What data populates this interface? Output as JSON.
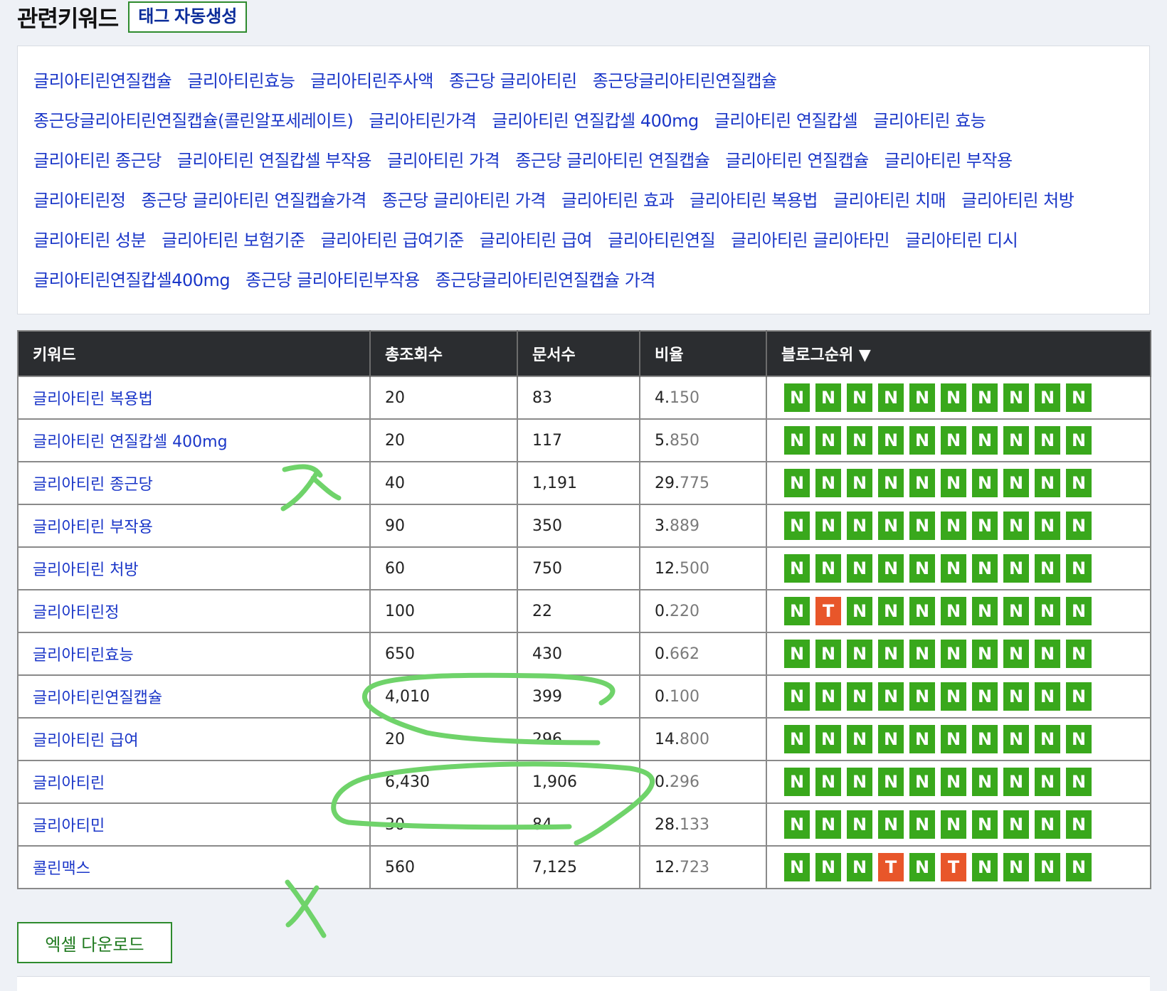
{
  "header": {
    "title": "관련키워드",
    "tag_button": "태그 자동생성"
  },
  "related_keywords": [
    [
      "글리아티린연질캡슐",
      "글리아티린효능",
      "글리아티린주사액",
      "종근당 글리아티린",
      "종근당글리아티린연질캡슐"
    ],
    [
      "종근당글리아티린연질캡슐(콜린알포세레이트)",
      "글리아티린가격",
      "글리아티린 연질캅셀 400mg",
      "글리아티린 연질캅셀",
      "글리아티린 효능"
    ],
    [
      "글리아티린 종근당",
      "글리아티린 연질캅셀 부작용",
      "글리아티린 가격",
      "종근당 글리아티린 연질캡슐",
      "글리아티린 연질캡슐",
      "글리아티린 부작용"
    ],
    [
      "글리아티린정",
      "종근당 글리아티린 연질캡슐가격",
      "종근당 글리아티린 가격",
      "글리아티린 효과",
      "글리아티린 복용법",
      "글리아티린 치매",
      "글리아티린 처방"
    ],
    [
      "글리아티린 성분",
      "글리아티린 보험기준",
      "글리아티린 급여기준",
      "글리아티린 급여",
      "글리아티린연질",
      "글리아티린 글리아타민",
      "글리아티린 디시"
    ],
    [
      "글리아티린연질캅셀400mg",
      "종근당 글리아티린부작용",
      "종근당글리아티린연질캡슐 가격"
    ]
  ],
  "table": {
    "headers": [
      "키워드",
      "총조회수",
      "문서수",
      "비율",
      "블로그순위 ▼"
    ],
    "rows": [
      {
        "keyword": "글리아티린 복용법",
        "views": "20",
        "docs": "83",
        "ratio_int": "4.",
        "ratio_dec": "150",
        "ranks": [
          "N",
          "N",
          "N",
          "N",
          "N",
          "N",
          "N",
          "N",
          "N",
          "N"
        ]
      },
      {
        "keyword": "글리아티린 연질캅셀 400mg",
        "views": "20",
        "docs": "117",
        "ratio_int": "5.",
        "ratio_dec": "850",
        "ranks": [
          "N",
          "N",
          "N",
          "N",
          "N",
          "N",
          "N",
          "N",
          "N",
          "N"
        ]
      },
      {
        "keyword": "글리아티린 종근당",
        "views": "40",
        "docs": "1,191",
        "ratio_int": "29.",
        "ratio_dec": "775",
        "ranks": [
          "N",
          "N",
          "N",
          "N",
          "N",
          "N",
          "N",
          "N",
          "N",
          "N"
        ]
      },
      {
        "keyword": "글리아티린 부작용",
        "views": "90",
        "docs": "350",
        "ratio_int": "3.",
        "ratio_dec": "889",
        "ranks": [
          "N",
          "N",
          "N",
          "N",
          "N",
          "N",
          "N",
          "N",
          "N",
          "N"
        ]
      },
      {
        "keyword": "글리아티린 처방",
        "views": "60",
        "docs": "750",
        "ratio_int": "12.",
        "ratio_dec": "500",
        "ranks": [
          "N",
          "N",
          "N",
          "N",
          "N",
          "N",
          "N",
          "N",
          "N",
          "N"
        ]
      },
      {
        "keyword": "글리아티린정",
        "views": "100",
        "docs": "22",
        "ratio_int": "0.",
        "ratio_dec": "220",
        "ranks": [
          "N",
          "T",
          "N",
          "N",
          "N",
          "N",
          "N",
          "N",
          "N",
          "N"
        ]
      },
      {
        "keyword": "글리아티린효능",
        "views": "650",
        "docs": "430",
        "ratio_int": "0.",
        "ratio_dec": "662",
        "ranks": [
          "N",
          "N",
          "N",
          "N",
          "N",
          "N",
          "N",
          "N",
          "N",
          "N"
        ]
      },
      {
        "keyword": "글리아티린연질캡슐",
        "views": "4,010",
        "docs": "399",
        "ratio_int": "0.",
        "ratio_dec": "100",
        "ranks": [
          "N",
          "N",
          "N",
          "N",
          "N",
          "N",
          "N",
          "N",
          "N",
          "N"
        ]
      },
      {
        "keyword": "글리아티린 급여",
        "views": "20",
        "docs": "296",
        "ratio_int": "14.",
        "ratio_dec": "800",
        "ranks": [
          "N",
          "N",
          "N",
          "N",
          "N",
          "N",
          "N",
          "N",
          "N",
          "N"
        ]
      },
      {
        "keyword": "글리아티린",
        "views": "6,430",
        "docs": "1,906",
        "ratio_int": "0.",
        "ratio_dec": "296",
        "ranks": [
          "N",
          "N",
          "N",
          "N",
          "N",
          "N",
          "N",
          "N",
          "N",
          "N"
        ]
      },
      {
        "keyword": "글리아티민",
        "views": "30",
        "docs": "84",
        "ratio_int": "28.",
        "ratio_dec": "133",
        "ranks": [
          "N",
          "N",
          "N",
          "N",
          "N",
          "N",
          "N",
          "N",
          "N",
          "N"
        ]
      },
      {
        "keyword": "콜린맥스",
        "views": "560",
        "docs": "7,125",
        "ratio_int": "12.",
        "ratio_dec": "723",
        "ranks": [
          "N",
          "N",
          "N",
          "T",
          "N",
          "T",
          "N",
          "N",
          "N",
          "N"
        ]
      }
    ]
  },
  "excel_button": "엑셀 다운로드",
  "colors": {
    "rank_n": "#39a81c",
    "rank_t": "#e8562a",
    "link": "#1a36c8",
    "annotation": "#6fd36a"
  }
}
